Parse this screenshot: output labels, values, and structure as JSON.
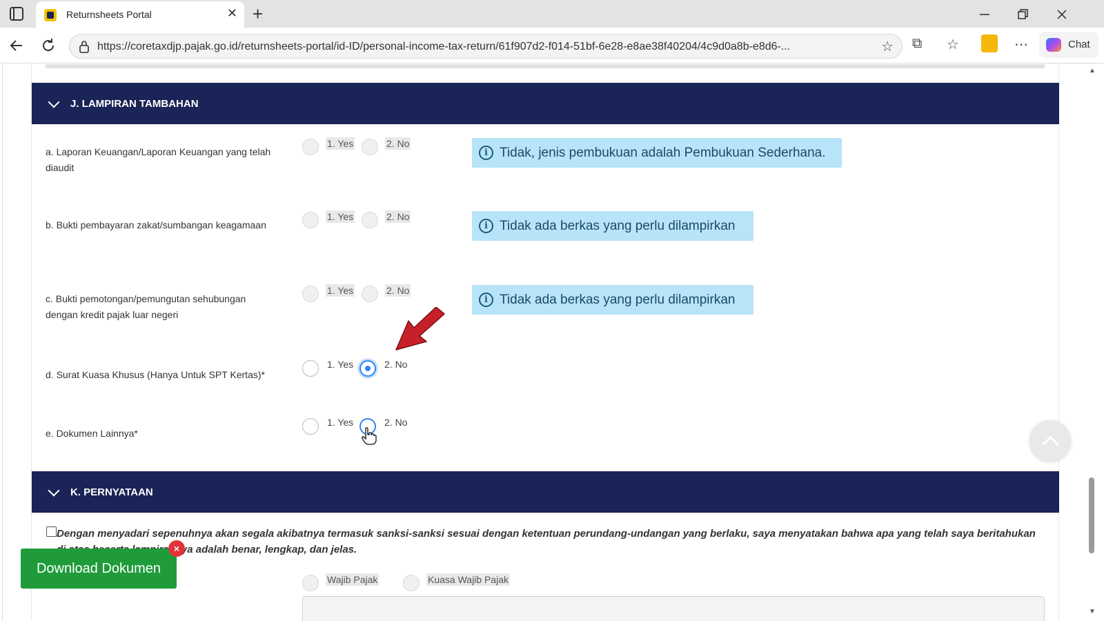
{
  "browser": {
    "tab_title": "Returnsheets Portal",
    "tab_close": "✕",
    "new_tab": "+",
    "url": "https://coretaxdjp.pajak.go.id/returnsheets-portal/id-ID/personal-income-tax-return/61f907d2-f014-51bf-6e28-e8ae38f40204/4c9d0a8b-e8d6-...",
    "chat_label": "Chat",
    "icons": [
      "sidebar-icon",
      "back-icon",
      "refresh-icon",
      "lock-icon",
      "favorite-star-icon",
      "extensions-icon",
      "favorites-icon",
      "calculator-icon",
      "more-icon",
      "copilot-icon",
      "minimize-icon",
      "restore-icon",
      "close-icon"
    ]
  },
  "sections": {
    "j_title": "J. LAMPIRAN TAMBAHAN",
    "k_title": "K. PERNYATAAN"
  },
  "questions": [
    {
      "label": "a. Laporan Keuangan/Laporan Keuangan yang telah diaudit",
      "opt_yes": "1. Yes",
      "opt_no": "2. No",
      "disabled": true,
      "selected": null,
      "info": "Tidak, jenis pembukuan adalah Pembukuan Sederhana."
    },
    {
      "label": "b. Bukti pembayaran zakat/sumbangan keagamaan",
      "opt_yes": "1. Yes",
      "opt_no": "2. No",
      "disabled": true,
      "selected": null,
      "info": "Tidak ada berkas yang perlu dilampirkan"
    },
    {
      "label": "c. Bukti pemotongan/pemungutan sehubungan dengan kredit pajak luar negeri",
      "opt_yes": "1. Yes",
      "opt_no": "2. No",
      "disabled": true,
      "selected": null,
      "info": "Tidak ada berkas yang perlu dilampirkan"
    },
    {
      "label": "d. Surat Kuasa Khusus (Hanya Untuk SPT Kertas)*",
      "opt_yes": "1. Yes",
      "opt_no": "2. No",
      "disabled": false,
      "selected": "no",
      "info": ""
    },
    {
      "label": "e. Dokumen Lainnya*",
      "opt_yes": "1. Yes",
      "opt_no": "2. No",
      "disabled": false,
      "selected": null,
      "info": ""
    }
  ],
  "declaration": {
    "text": "Dengan menyadari sepenuhnya akan segala akibatnya termasuk sanksi-sanksi sesuai dengan ketentuan perundang-undangan yang berlaku, saya menyatakan bahwa apa yang telah saya beritahukan di atas beserta lampirannya adalah benar, lengkap, dan jelas.",
    "checked": false
  },
  "signer": {
    "opt_taxpayer": "Wajib Pajak",
    "opt_proxy": "Kuasa Wajib Pajak"
  },
  "download_button": "Download Dokumen",
  "download_close": "×",
  "accent_colors": {
    "section_header": "#1b2456",
    "info_box": "#b7e4f8",
    "download_button": "#1f9b3a",
    "radio_selected": "#2f86f0",
    "annotation_arrow": "#c8202a"
  }
}
